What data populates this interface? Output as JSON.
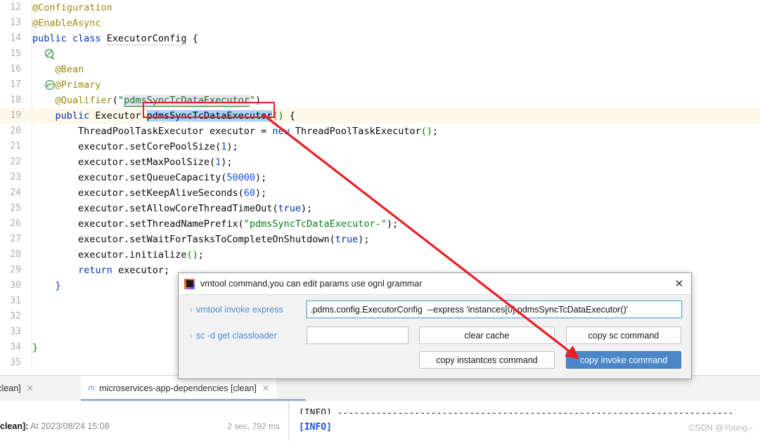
{
  "editor": {
    "first_line_number": 12,
    "lines": [
      {
        "n": 12,
        "text": "@Configuration",
        "gutter_icon": "",
        "current": false
      },
      {
        "n": 13,
        "text": "@EnableAsync",
        "gutter_icon": "",
        "current": false
      },
      {
        "n": 14,
        "text": "public class ExecutorConfig {",
        "gutter_icon": "no-usage-icon",
        "current": false
      },
      {
        "n": 15,
        "text": "",
        "gutter_icon": "",
        "current": false
      },
      {
        "n": 16,
        "text": "    @Bean",
        "gutter_icon": "spring-bean-icon",
        "current": false
      },
      {
        "n": 17,
        "text": "    @Primary",
        "gutter_icon": "",
        "current": false
      },
      {
        "n": 18,
        "text": "    @Qualifier(\"pdmsSyncTcDataExecutor\")",
        "gutter_icon": "",
        "current": false
      },
      {
        "n": 19,
        "text": "    public Executor pdmsSyncTcDataExecutor() {",
        "gutter_icon": "",
        "current": true
      },
      {
        "n": 20,
        "text": "        ThreadPoolTaskExecutor executor = new ThreadPoolTaskExecutor();",
        "gutter_icon": "",
        "current": false
      },
      {
        "n": 21,
        "text": "        executor.setCorePoolSize(1);",
        "gutter_icon": "",
        "current": false
      },
      {
        "n": 22,
        "text": "        executor.setMaxPoolSize(1);",
        "gutter_icon": "",
        "current": false
      },
      {
        "n": 23,
        "text": "        executor.setQueueCapacity(50000);",
        "gutter_icon": "",
        "current": false
      },
      {
        "n": 24,
        "text": "        executor.setKeepAliveSeconds(60);",
        "gutter_icon": "",
        "current": false
      },
      {
        "n": 25,
        "text": "        executor.setAllowCoreThreadTimeOut(true);",
        "gutter_icon": "",
        "current": false
      },
      {
        "n": 26,
        "text": "        executor.setThreadNamePrefix(\"pdmsSyncTcDataExecutor-\");",
        "gutter_icon": "",
        "current": false
      },
      {
        "n": 27,
        "text": "        executor.setWaitForTasksToCompleteOnShutdown(true);",
        "gutter_icon": "",
        "current": false
      },
      {
        "n": 28,
        "text": "        executor.initialize();",
        "gutter_icon": "",
        "current": false
      },
      {
        "n": 29,
        "text": "        return executor;",
        "gutter_icon": "",
        "current": false
      },
      {
        "n": 30,
        "text": "    }",
        "gutter_icon": "",
        "current": false
      },
      {
        "n": 31,
        "text": "",
        "gutter_icon": "",
        "current": false
      },
      {
        "n": 32,
        "text": "",
        "gutter_icon": "",
        "current": false
      },
      {
        "n": 33,
        "text": "",
        "gutter_icon": "",
        "current": false
      },
      {
        "n": 34,
        "text": "}",
        "gutter_icon": "",
        "current": false
      },
      {
        "n": 35,
        "text": "",
        "gutter_icon": "",
        "current": false
      }
    ],
    "selected_token": "pdmsSyncTcDataExecutor",
    "annotation_color": "#ec1c24"
  },
  "dialog": {
    "title": "vmtool command,you can edit params use ognl grammar",
    "icon": "intellij-idea-icon",
    "close_label": "✕",
    "rows": [
      {
        "label": "vmtool invoke express",
        "chevron": "›",
        "value": ".pdms.config.ExecutorConfig  --express 'instances[0].pdmsSyncTcDataExecutor()'",
        "placeholder": ""
      },
      {
        "label": "sc -d get classloader",
        "chevron": "›",
        "value": "",
        "placeholder": ""
      }
    ],
    "buttons": {
      "clear_cache": "clear cache",
      "copy_sc": "copy sc command",
      "copy_instances": "copy instantces command",
      "copy_invoke": "copy invoke command"
    },
    "primary_button_color": "#4a86c8"
  },
  "bottom": {
    "tabs": [
      {
        "label": "cation [clean]",
        "icon": "",
        "close": "✕",
        "active": false
      },
      {
        "label": "microservices-app-dependencies [clean]",
        "icon": "maven-icon",
        "icon_glyph": "m",
        "close": "✕",
        "active": true
      }
    ],
    "status_prefix": "clean]:",
    "status_text": "At 2023/08/24 15:08",
    "duration": "2 sec, 792 ms",
    "console_level": "[INFO]",
    "watermark": "CSDN @Young--"
  }
}
